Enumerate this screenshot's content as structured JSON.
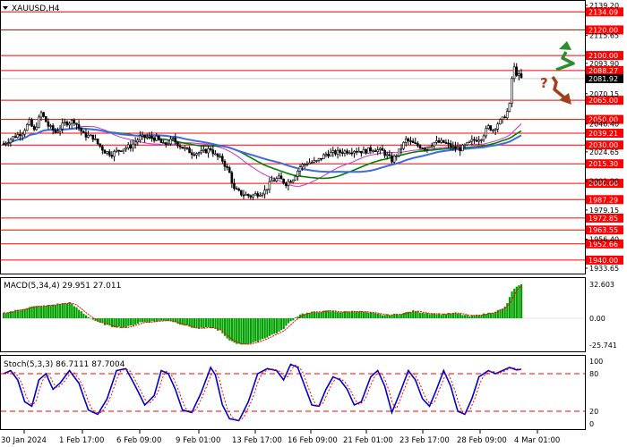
{
  "title": "XAUUSD,H4",
  "macd_label": "MACD(5,34,4) 29.951 27.011",
  "stoch_label": "Stoch(5,3,3) 86.7111 87.7004",
  "colors": {
    "level_line": "#ff0000",
    "level_bg": "#ff0000",
    "grid": "#000000",
    "ma_green": "#008000",
    "ma_blue": "#4169e1",
    "ma_purple": "#cc33cc",
    "macd_bar": "#00a000",
    "signal": "#ff0000",
    "stoch_main": "#0000cc",
    "stoch_signal": "#ff0000",
    "arrow_up": "#2e8b2e",
    "arrow_down": "#a0401f"
  },
  "icons": [
    "dropdown-triangle-icon",
    "arrow-up-icon",
    "question-mark-icon",
    "arrow-down-icon"
  ],
  "question_mark": "?",
  "chart_data": [
    {
      "type": "candlestick",
      "title": "XAUUSD,H4",
      "ylim": [
        1933.65,
        2139.2
      ],
      "price_axis_ticks": [
        "2139.20",
        "2115.65",
        "2093.90",
        "2070.15",
        "2046.40",
        "2024.65",
        "2001.90",
        "1979.15",
        "1956.40",
        "1933.65"
      ],
      "levels": [
        "2134.09",
        "2120.00",
        "2100.00",
        "2088.27",
        "2065.00",
        "2050.00",
        "2039.21",
        "2030.00",
        "2015.30",
        "2000.00",
        "1987.29",
        "1972.85",
        "1963.55",
        "1952.66",
        "1940.00"
      ],
      "current_price": "2081.92",
      "x_labels": [
        "30 Jan 2024",
        "1 Feb 17:00",
        "6 Feb 09:00",
        "9 Feb 01:00",
        "13 Feb 17:00",
        "16 Feb 09:00",
        "21 Feb 01:00",
        "23 Feb 17:00",
        "28 Feb 09:00",
        "4 Mar 01:00"
      ],
      "close_path": [
        [
          0,
          2031
        ],
        [
          4,
          2036
        ],
        [
          8,
          2040
        ],
        [
          11,
          2048
        ],
        [
          13,
          2041
        ],
        [
          16,
          2055
        ],
        [
          19,
          2045
        ],
        [
          22,
          2040
        ],
        [
          26,
          2047
        ],
        [
          30,
          2049
        ],
        [
          34,
          2038
        ],
        [
          38,
          2036
        ],
        [
          40,
          2031
        ],
        [
          43,
          2025
        ],
        [
          46,
          2023
        ],
        [
          50,
          2027
        ],
        [
          54,
          2029
        ],
        [
          58,
          2036
        ],
        [
          62,
          2036
        ],
        [
          65,
          2035
        ],
        [
          68,
          2030
        ],
        [
          72,
          2034
        ],
        [
          76,
          2028
        ],
        [
          80,
          2024
        ],
        [
          84,
          2024
        ],
        [
          88,
          2027
        ],
        [
          90,
          2022
        ],
        [
          93,
          2018
        ],
        [
          96,
          2008
        ],
        [
          98,
          1995
        ],
        [
          101,
          1992
        ],
        [
          105,
          1990
        ],
        [
          108,
          1992
        ],
        [
          111,
          1994
        ],
        [
          114,
          2002
        ],
        [
          117,
          2004
        ],
        [
          120,
          2000
        ],
        [
          123,
          2004
        ],
        [
          126,
          2013
        ],
        [
          129,
          2016
        ],
        [
          133,
          2017
        ],
        [
          137,
          2023
        ],
        [
          141,
          2024
        ],
        [
          145,
          2025
        ],
        [
          149,
          2026
        ],
        [
          153,
          2025
        ],
        [
          157,
          2027
        ],
        [
          161,
          2025
        ],
        [
          165,
          2018
        ],
        [
          168,
          2025
        ],
        [
          171,
          2034
        ],
        [
          175,
          2030
        ],
        [
          179,
          2028
        ],
        [
          183,
          2032
        ],
        [
          187,
          2032
        ],
        [
          191,
          2028
        ],
        [
          194,
          2027
        ],
        [
          196,
          2029
        ],
        [
          199,
          2033
        ],
        [
          203,
          2036
        ],
        [
          206,
          2044
        ],
        [
          208,
          2042
        ],
        [
          210,
          2047
        ],
        [
          212,
          2050
        ],
        [
          214,
          2056
        ],
        [
          215,
          2061
        ],
        [
          216,
          2082
        ],
        [
          217,
          2090
        ],
        [
          218,
          2086
        ],
        [
          219,
          2084
        ],
        [
          220,
          2082
        ]
      ]
    },
    {
      "type": "bar",
      "title": "MACD(5,34,4) 29.951 27.011",
      "name": "MACD",
      "values": [
        29.951
      ],
      "signal": [
        27.011
      ],
      "ylim": [
        -25.741,
        32.603
      ],
      "axis_ticks": [
        "32.603",
        "0.00",
        "-25.741"
      ],
      "macd_path": [
        [
          0,
          5
        ],
        [
          6,
          8
        ],
        [
          12,
          11
        ],
        [
          18,
          12
        ],
        [
          24,
          14
        ],
        [
          28,
          15
        ],
        [
          31,
          10
        ],
        [
          35,
          3
        ],
        [
          40,
          -4
        ],
        [
          46,
          -8
        ],
        [
          52,
          -9
        ],
        [
          58,
          -4
        ],
        [
          64,
          -3
        ],
        [
          70,
          -2
        ],
        [
          76,
          -6
        ],
        [
          82,
          -10
        ],
        [
          88,
          -9
        ],
        [
          92,
          -12
        ],
        [
          95,
          -20
        ],
        [
          100,
          -25
        ],
        [
          106,
          -24
        ],
        [
          112,
          -18
        ],
        [
          118,
          -12
        ],
        [
          122,
          -3
        ],
        [
          126,
          4
        ],
        [
          132,
          6
        ],
        [
          138,
          7
        ],
        [
          144,
          6
        ],
        [
          150,
          7
        ],
        [
          156,
          5
        ],
        [
          162,
          3
        ],
        [
          168,
          4
        ],
        [
          174,
          7
        ],
        [
          180,
          5
        ],
        [
          186,
          4
        ],
        [
          192,
          5
        ],
        [
          198,
          2
        ],
        [
          204,
          4
        ],
        [
          208,
          6
        ],
        [
          212,
          9
        ],
        [
          214,
          14
        ],
        [
          216,
          26
        ],
        [
          218,
          30
        ],
        [
          220,
          32
        ]
      ]
    },
    {
      "type": "line",
      "title": "Stoch(5,3,3) 86.7111 87.7004",
      "ylim": [
        0,
        100
      ],
      "axis_ticks": [
        "100",
        "80",
        "20",
        "0"
      ],
      "levels": [
        80,
        20
      ],
      "values": [
        86.7111,
        87.7004
      ],
      "stoch_path": [
        [
          0,
          80
        ],
        [
          3,
          85
        ],
        [
          6,
          70
        ],
        [
          9,
          35
        ],
        [
          12,
          28
        ],
        [
          15,
          70
        ],
        [
          18,
          80
        ],
        [
          21,
          55
        ],
        [
          24,
          65
        ],
        [
          28,
          85
        ],
        [
          32,
          65
        ],
        [
          36,
          22
        ],
        [
          40,
          15
        ],
        [
          44,
          40
        ],
        [
          48,
          85
        ],
        [
          52,
          88
        ],
        [
          56,
          60
        ],
        [
          60,
          30
        ],
        [
          64,
          45
        ],
        [
          67,
          85
        ],
        [
          70,
          80
        ],
        [
          73,
          55
        ],
        [
          76,
          22
        ],
        [
          80,
          18
        ],
        [
          84,
          50
        ],
        [
          88,
          90
        ],
        [
          90,
          78
        ],
        [
          93,
          30
        ],
        [
          96,
          8
        ],
        [
          100,
          5
        ],
        [
          104,
          35
        ],
        [
          108,
          80
        ],
        [
          112,
          88
        ],
        [
          116,
          85
        ],
        [
          119,
          70
        ],
        [
          122,
          95
        ],
        [
          125,
          90
        ],
        [
          128,
          60
        ],
        [
          131,
          30
        ],
        [
          134,
          28
        ],
        [
          137,
          55
        ],
        [
          140,
          75
        ],
        [
          143,
          70
        ],
        [
          146,
          55
        ],
        [
          149,
          30
        ],
        [
          152,
          35
        ],
        [
          156,
          75
        ],
        [
          159,
          85
        ],
        [
          162,
          60
        ],
        [
          165,
          18
        ],
        [
          169,
          55
        ],
        [
          172,
          85
        ],
        [
          175,
          70
        ],
        [
          178,
          40
        ],
        [
          181,
          28
        ],
        [
          184,
          55
        ],
        [
          187,
          85
        ],
        [
          190,
          60
        ],
        [
          193,
          20
        ],
        [
          196,
          15
        ],
        [
          199,
          40
        ],
        [
          202,
          75
        ],
        [
          206,
          85
        ],
        [
          209,
          80
        ],
        [
          212,
          85
        ],
        [
          215,
          90
        ],
        [
          218,
          86
        ],
        [
          220,
          87
        ]
      ]
    }
  ]
}
